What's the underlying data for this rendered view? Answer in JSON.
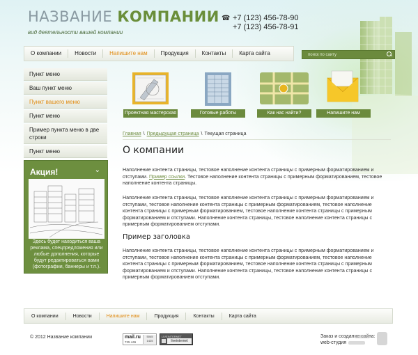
{
  "header": {
    "title_prefix": "НАЗВАНИЕ ",
    "title_bold": "КОМПАНИИ",
    "tagline": "вид деятельности вашей компании",
    "phones": [
      "+7 (123) 456-78-90",
      "+7 (123) 456-78-91"
    ]
  },
  "nav": {
    "items": [
      "О компании",
      "Новости",
      "Напишите нам",
      "Продукция",
      "Контакты",
      "Карта сайта"
    ],
    "active_index": 2
  },
  "search": {
    "placeholder": "поиск по сайту"
  },
  "sidebar": {
    "items": [
      "Пункт меню",
      "Ваш пункт меню",
      "Пункт вашего меню",
      "Пункт меню",
      "Пример пункта меню в две строки",
      "Пункт меню"
    ],
    "active_index": 2
  },
  "promo": {
    "title": "Акция!",
    "text": "Здесь будет находиться ваша реклама, спецпредложения или любые дополнения, которые будут редактироваться вами (фотографии, баннеры и т.п.)."
  },
  "tiles": [
    "Проектная мастерская",
    "Готовые работы",
    "Как нас найти?",
    "Напишите нам"
  ],
  "breadcrumb": {
    "items": [
      "Главная",
      "Предыдущая страница"
    ],
    "current": "Текущая страница",
    "separator": "\\"
  },
  "content": {
    "h1": "О компании",
    "p1_before": "Наполнение контента страницы, тестовое наполнение контента страницы с примерным форматированием и отступами. ",
    "p1_link": "Пример ссылки",
    "p1_after": ". Тестовое наполнение контента страницы с примерным форматированием, тестовое наполнение контента страницы.",
    "p2": "Наполнение контента страницы, тестовое наполнение контента страницы с примерным форматированием и отступами, тестовое наполнение контента страницы с примерным форматированием, тестовое наполнение контента страницы с примерным форматированием, тестовое наполнение контента страницы с примерным форматированием и отступами. Наполнение контента страницы, тестовое наполнение контента страницы с примерным форматированием отступами.",
    "h2": "Пример заголовка",
    "p3": "Наполнение контента страницы, тестовое наполнение контента страницы с примерным форматированием и отступами, тестовое наполнение контента страницы с примерным форматированием, тестовое наполнение контента страницы с примерным форматированием, тестовое наполнение контента страницы с примерным форматированием и отступами. Наполнение контента страницы, тестовое наполнение контента страницы с примерным форматированием отступами."
  },
  "footer": {
    "nav": [
      "О компании",
      "Новости",
      "Напишите нам",
      "Продукция",
      "Контакты",
      "Карта сайта"
    ],
    "active_index": 2,
    "copyright": "© 2012   Название компании",
    "badge_mail": "mail.ru",
    "badge_mail_sub": "725 446",
    "badge_mail_nums": "5045\n1425",
    "badge_li_top": "LIVEINTERNET",
    "badge_li": "liveinternet",
    "credit_lines": [
      "Заказ и создание сайта:",
      "web-студия"
    ]
  },
  "colors": {
    "accent": "#6b8a3d",
    "active": "#e08a10"
  }
}
